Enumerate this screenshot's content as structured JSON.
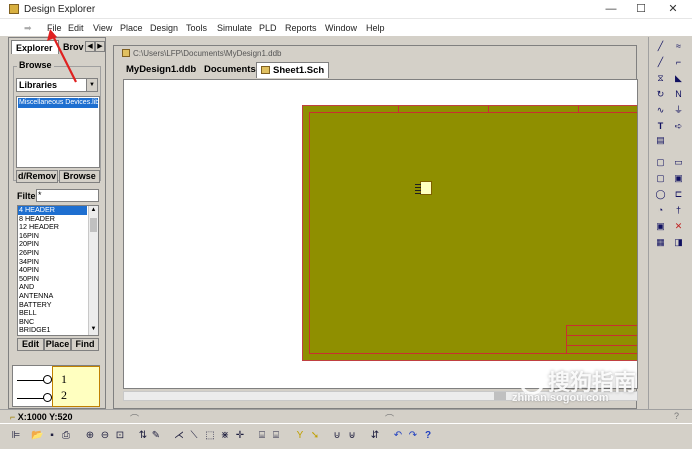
{
  "window": {
    "title": "Design Explorer",
    "controls": [
      "—",
      "☐",
      "✕"
    ]
  },
  "menu": {
    "items": [
      "File",
      "Edit",
      "View",
      "Place",
      "Design",
      "Tools",
      "Simulate",
      "PLD",
      "Reports",
      "Window",
      "Help"
    ]
  },
  "left_panel": {
    "tabs": [
      "Explorer",
      "Brov"
    ],
    "browse_title": "Browse",
    "browse_mode": "Libraries",
    "selected_library": "Miscellaneous Devices.lib",
    "buttons": {
      "add_remove": "d/Remov",
      "browse": "Browse"
    },
    "filter_label": "Filte",
    "filter_value": "*",
    "components": [
      "4 HEADER",
      "8 HEADER",
      "12 HEADER",
      "16PIN",
      "20PIN",
      "26PIN",
      "34PIN",
      "40PIN",
      "50PIN",
      "AND",
      "ANTENNA",
      "BATTERY",
      "BELL",
      "BNC",
      "BRIDGE1"
    ],
    "selected_component_index": 0,
    "action_buttons": {
      "edit": "Edit",
      "place": "Place",
      "find": "Find"
    },
    "preview_pins": [
      "1",
      "2"
    ]
  },
  "document": {
    "path": "C:\\Users\\LFP\\Documents\\MyDesign1.ddb",
    "tabs": [
      "MyDesign1.ddb",
      "Documents",
      "Sheet1.Sch"
    ],
    "active_tab_index": 2
  },
  "status": {
    "coordinates": "X:1000 Y:520"
  },
  "watermark": {
    "main": "搜狗指南",
    "sub": "zhinan.sogou.com"
  },
  "colors": {
    "sheet": "#8f8f00",
    "sheet_border": "#c83030",
    "selection": "#1e6fd0",
    "annotation_arrow": "#e02020"
  },
  "icons": {
    "right_toolbar": [
      "wire-icon",
      "bus-icon",
      "bus-entry-icon",
      "net-label-icon",
      "power-port-icon",
      "ground-icon",
      "junction-icon",
      "port-icon",
      "text-icon",
      "sheet-symbol-icon",
      "part-icon",
      "sheet-entry-icon",
      "ellipse-icon",
      "directive-icon",
      "pie-icon",
      "no-erc-icon",
      "image-icon",
      "array-icon",
      "probe-icon"
    ],
    "bottom_toolbar": [
      "panel-toggle-icon",
      "open-icon",
      "save-icon",
      "print-icon",
      "zoom-in-icon",
      "zoom-out-icon",
      "zoom-fit-icon",
      "hierarchy-icon",
      "pencil-icon",
      "cross-probe-icon",
      "select-icon",
      "move-icon",
      "cross-icon",
      "library-icon",
      "part-browser-icon",
      "help-icon"
    ]
  }
}
